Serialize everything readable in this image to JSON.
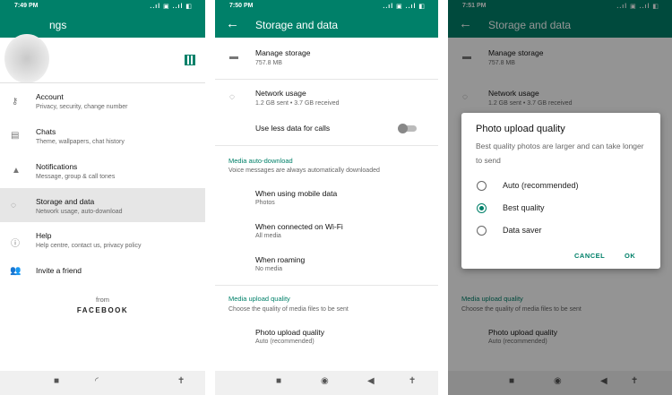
{
  "colors": {
    "primary": "#008069",
    "dim_overlay": "#000000"
  },
  "panel1": {
    "time": "7:49 PM",
    "status_icons": "..ıl ▣ ..ıl ◧",
    "title_partial": "ngs",
    "qr_icon": "qr-code-icon",
    "items": [
      {
        "title": "Account",
        "sub": "Privacy, security, change number",
        "icon": "key-icon"
      },
      {
        "title": "Chats",
        "sub": "Theme, wallpapers, chat history",
        "icon": "chat-icon"
      },
      {
        "title": "Notifications",
        "sub": "Message, group & call tones",
        "icon": "bell-icon"
      },
      {
        "title": "Storage and data",
        "sub": "Network usage, auto-download",
        "icon": "storage-icon"
      },
      {
        "title": "Help",
        "sub": "Help centre, contact us, privacy policy",
        "icon": "help-icon"
      },
      {
        "title": "Invite a friend",
        "sub": "",
        "icon": "people-icon"
      }
    ],
    "from": "from",
    "brand": "FACEBOOK"
  },
  "panel2": {
    "time": "7:50 PM",
    "status_icons": "..ıl ▣ ..ıl ◧",
    "title": "Storage and data",
    "manage_title": "Manage storage",
    "manage_sub": "757.8 MB",
    "network_title": "Network usage",
    "network_sub": "1.2 GB sent • 3.7 GB received",
    "less_data": "Use less data for calls",
    "section_auto": "Media auto-download",
    "section_auto_sub": "Voice messages are always automatically downloaded",
    "mobile_title": "When using mobile data",
    "mobile_sub": "Photos",
    "wifi_title": "When connected on Wi-Fi",
    "wifi_sub": "All media",
    "roaming_title": "When roaming",
    "roaming_sub": "No media",
    "section_upload": "Media upload quality",
    "section_upload_sub": "Choose the quality of media files to be sent",
    "photo_title": "Photo upload quality",
    "photo_sub": "Auto (recommended)"
  },
  "panel3": {
    "time": "7:51 PM",
    "dialog_title": "Photo upload quality",
    "dialog_desc": "Best quality photos are larger and can take longer to send",
    "options": [
      {
        "label": "Auto (recommended)",
        "selected": false
      },
      {
        "label": "Best quality",
        "selected": true
      },
      {
        "label": "Data saver",
        "selected": false
      }
    ],
    "cancel": "CANCEL",
    "ok": "OK"
  }
}
